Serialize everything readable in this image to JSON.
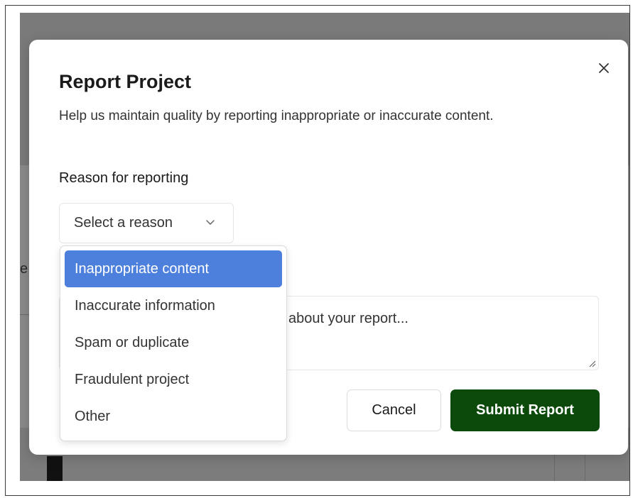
{
  "modal": {
    "title": "Report Project",
    "description": "Help us maintain quality by reporting inappropriate or inaccurate content.",
    "close_icon": "close-icon"
  },
  "reason": {
    "label": "Reason for reporting",
    "select_placeholder": "Select a reason",
    "options": [
      {
        "label": "Inappropriate content",
        "highlighted": true
      },
      {
        "label": "Inaccurate information",
        "highlighted": false
      },
      {
        "label": "Spam or duplicate",
        "highlighted": false
      },
      {
        "label": "Fraudulent project",
        "highlighted": false
      },
      {
        "label": "Other",
        "highlighted": false
      }
    ]
  },
  "details": {
    "placeholder_visible": "about your report..."
  },
  "actions": {
    "cancel_label": "Cancel",
    "submit_label": "Submit Report"
  },
  "colors": {
    "submit_bg": "#0b4a0b",
    "highlight_bg": "#4d7fdc",
    "overlay": "#7a7a7a"
  },
  "background": {
    "partial_letter": "e"
  }
}
